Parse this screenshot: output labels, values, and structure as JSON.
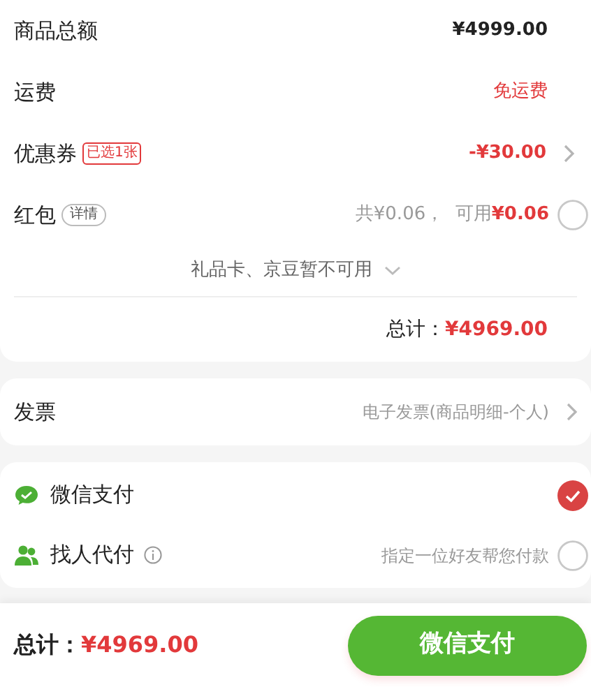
{
  "summary": {
    "rows": [
      {
        "kind": "plain",
        "label": "商品总额",
        "value": "¥4999.00",
        "emphasis": false
      },
      {
        "kind": "plain",
        "label": "运费",
        "value": "免运费",
        "emphasis": true
      },
      {
        "kind": "coupon",
        "label": "优惠券",
        "tag": "已选1张",
        "value": "-¥30.00"
      },
      {
        "kind": "packet",
        "label": "红包",
        "tag": "详情",
        "note": "共¥0.06，  可用",
        "value": "¥0.06",
        "checked": false
      }
    ],
    "unavailable": "礼品卡、京豆暂不可用",
    "total_label": "总计：",
    "total": "¥4969.00"
  },
  "invoice": {
    "label": "发票",
    "value": "电子发票(商品明细-个人)"
  },
  "payments": [
    {
      "kind": "wechat",
      "label": "微信支付",
      "selected": true
    },
    {
      "kind": "friend",
      "label": "找人代付",
      "hint": "指定一位好友帮您付款",
      "selected": false
    }
  ],
  "footer": {
    "total_label": "总计：",
    "total": "¥4969.00",
    "button": "微信支付"
  }
}
